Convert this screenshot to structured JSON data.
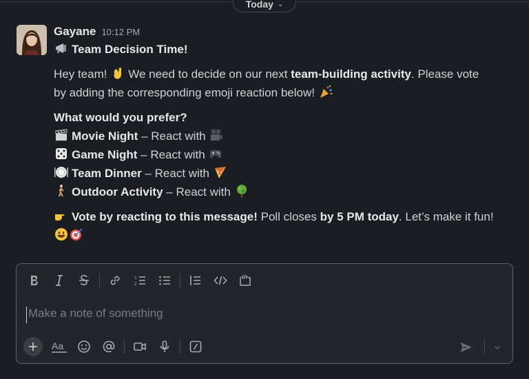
{
  "date_divider": {
    "label": "Today"
  },
  "message": {
    "author": "Gayane",
    "time": "10:12 PM",
    "title": "Team Decision Time!",
    "intro_a": "Hey team!",
    "intro_b": "We need to decide on our next",
    "intro_bold": "team-building activity",
    "intro_c": ". Please vote",
    "intro_line2": "by adding the corresponding emoji reaction below!",
    "question": "What would you prefer?",
    "options": [
      {
        "name": "Movie Night",
        "suffix": "– React with",
        "icon": "clapper-icon",
        "react_icon": "movie-camera-icon"
      },
      {
        "name": "Game Night",
        "suffix": "– React with",
        "icon": "dice-icon",
        "react_icon": "game-controller-icon"
      },
      {
        "name": "Team Dinner",
        "suffix": "– React with",
        "icon": "plate-icon",
        "react_icon": "pizza-icon"
      },
      {
        "name": "Outdoor Activity",
        "suffix": "– React with",
        "icon": "walking-person-icon",
        "react_icon": "tree-icon"
      }
    ],
    "cta_bold": "Vote by reacting to this message!",
    "cta_mid": "Poll closes",
    "cta_bold2": "by 5 PM today",
    "cta_end": ". Let’s make it fun!"
  },
  "composer": {
    "placeholder": "Make a note of something",
    "format_tools": [
      "bold-icon",
      "italic-icon",
      "strikethrough-icon",
      "link-icon",
      "ordered-list-icon",
      "bulleted-list-icon",
      "blockquote-icon",
      "code-icon",
      "code-block-icon"
    ],
    "bottom_tools": [
      "plus-icon",
      "text-format-icon",
      "emoji-icon",
      "mention-icon",
      "video-icon",
      "microphone-icon",
      "slash-command-icon"
    ]
  },
  "colors": {
    "background": "#1a1d21",
    "composer_bg": "#222529",
    "text": "#d1d2d3"
  }
}
